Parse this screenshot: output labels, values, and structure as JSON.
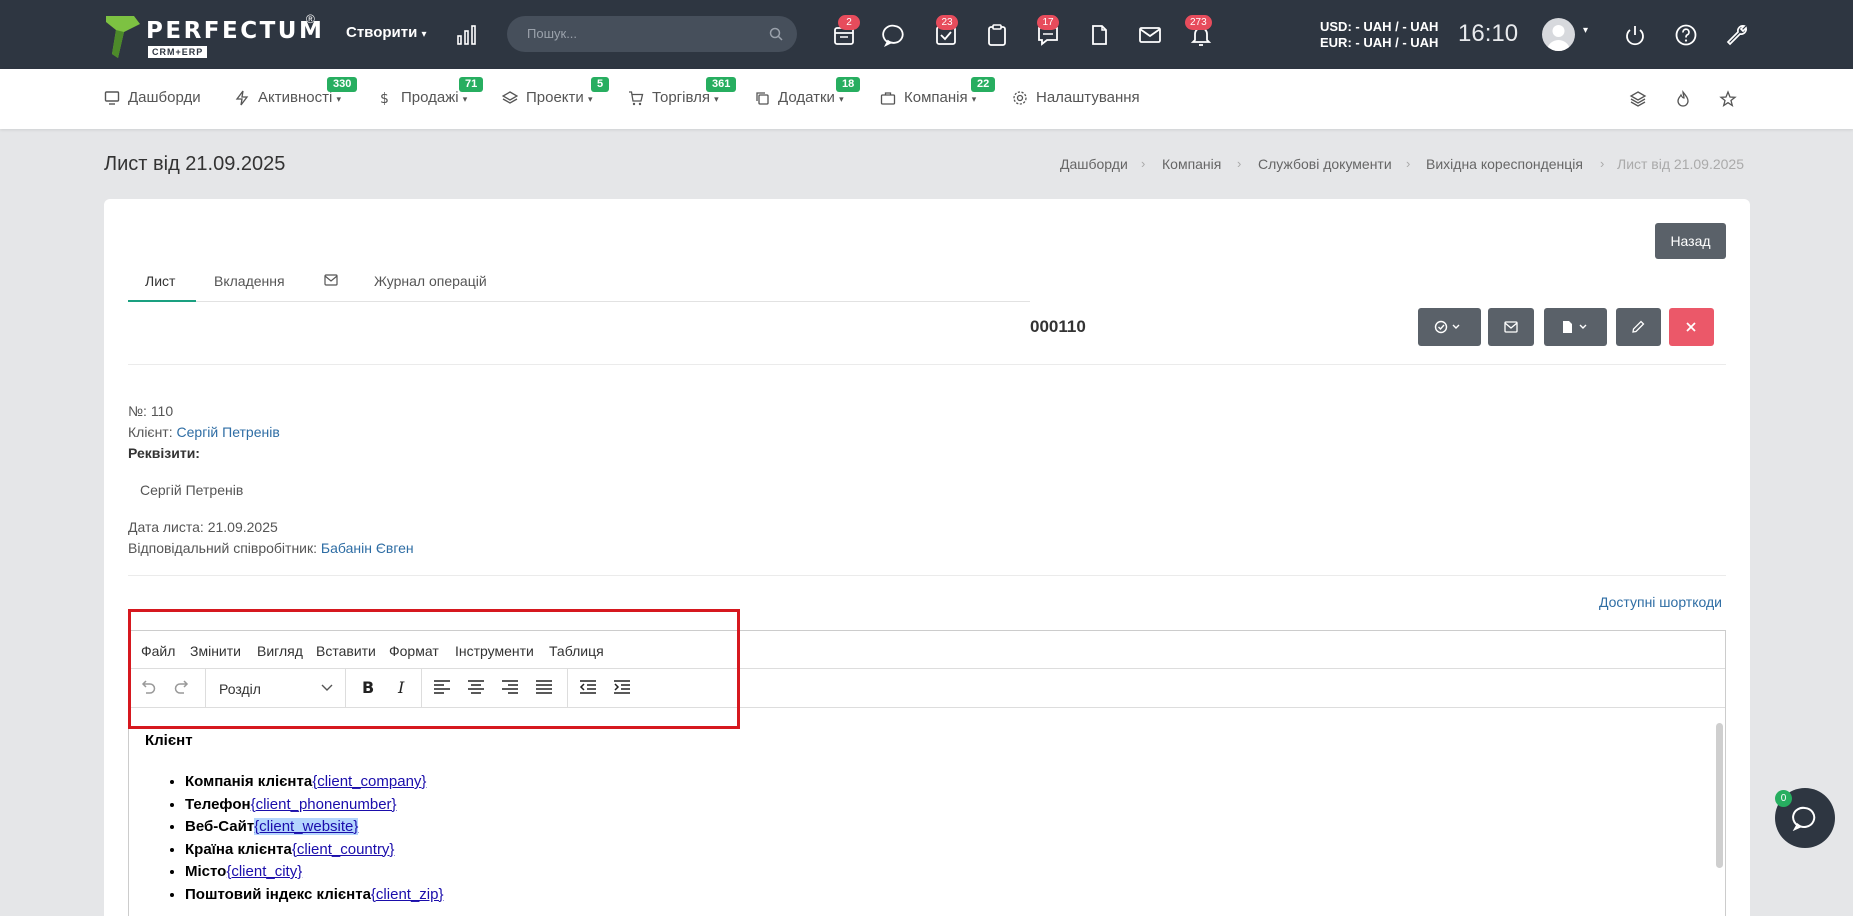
{
  "brand": {
    "name": "PERFECTUM",
    "sub": "CRM+ERP",
    "reg": "®"
  },
  "topbar": {
    "create_label": "Створити",
    "search_placeholder": "Пошук...",
    "badges": {
      "tasks": "2",
      "deals": "23",
      "comments": "17",
      "notifications": "273"
    },
    "fx_usd": "USD: - UAH / - UAH",
    "fx_eur": "EUR: - UAH / - UAH",
    "time": "16:10"
  },
  "nav": {
    "dashboards": "Дашборди",
    "activities": "Активності",
    "activities_badge": "330",
    "sales": "Продажі",
    "sales_badge": "71",
    "projects": "Проекти",
    "projects_badge": "5",
    "trade": "Торгівля",
    "trade_badge": "361",
    "addons": "Додатки",
    "addons_badge": "18",
    "company": "Компанія",
    "company_badge": "22",
    "settings": "Налаштування"
  },
  "page": {
    "title": "Лист від 21.09.2025",
    "breadcrumb": [
      "Дашборди",
      "Компанія",
      "Службові документи",
      "Вихідна кореспонденція",
      "Лист від 21.09.2025"
    ]
  },
  "card": {
    "back_label": "Назад",
    "tabs": [
      "Лист",
      "Вкладення",
      "Журнал операцій"
    ],
    "doc_number": "000110"
  },
  "info": {
    "number_label": "№:",
    "number_value": "110",
    "client_label": "Клієнт:",
    "client_value": "Сергій Петренів",
    "requisites_label": "Реквізити:",
    "requisites_value": "Сергій Петренів",
    "date_label": "Дата листа:",
    "date_value": "21.09.2025",
    "responsible_label": "Відповідальний співробітник:",
    "responsible_value": "Бабанін Євген"
  },
  "shortcodes_label": "Доступні шорткоди",
  "editor": {
    "menus": [
      "Файл",
      "Змінити",
      "Вигляд",
      "Вставити",
      "Формат",
      "Інструменти",
      "Таблиця"
    ],
    "block_format": "Розділ",
    "heading": "Клієнт",
    "items": [
      {
        "label": "Компанія клієнта",
        "code": "{client_company}"
      },
      {
        "label": "Телефон",
        "code": "{client_phonenumber}"
      },
      {
        "label": "Веб-Сайт",
        "code": "{client_website}"
      },
      {
        "label": "Країна клієнта",
        "code": "{client_country}"
      },
      {
        "label": "Місто",
        "code": "{client_city}"
      },
      {
        "label": "Поштовий індекс клієнта",
        "code": "{client_zip}"
      }
    ]
  },
  "chat_badge": "0",
  "colors": {
    "topbar": "#2e3641",
    "accent": "#1aa080",
    "badge_green": "#27ae60",
    "badge_red": "#e74c5c",
    "danger": "#eb5869",
    "highlight": "#d6181f"
  }
}
